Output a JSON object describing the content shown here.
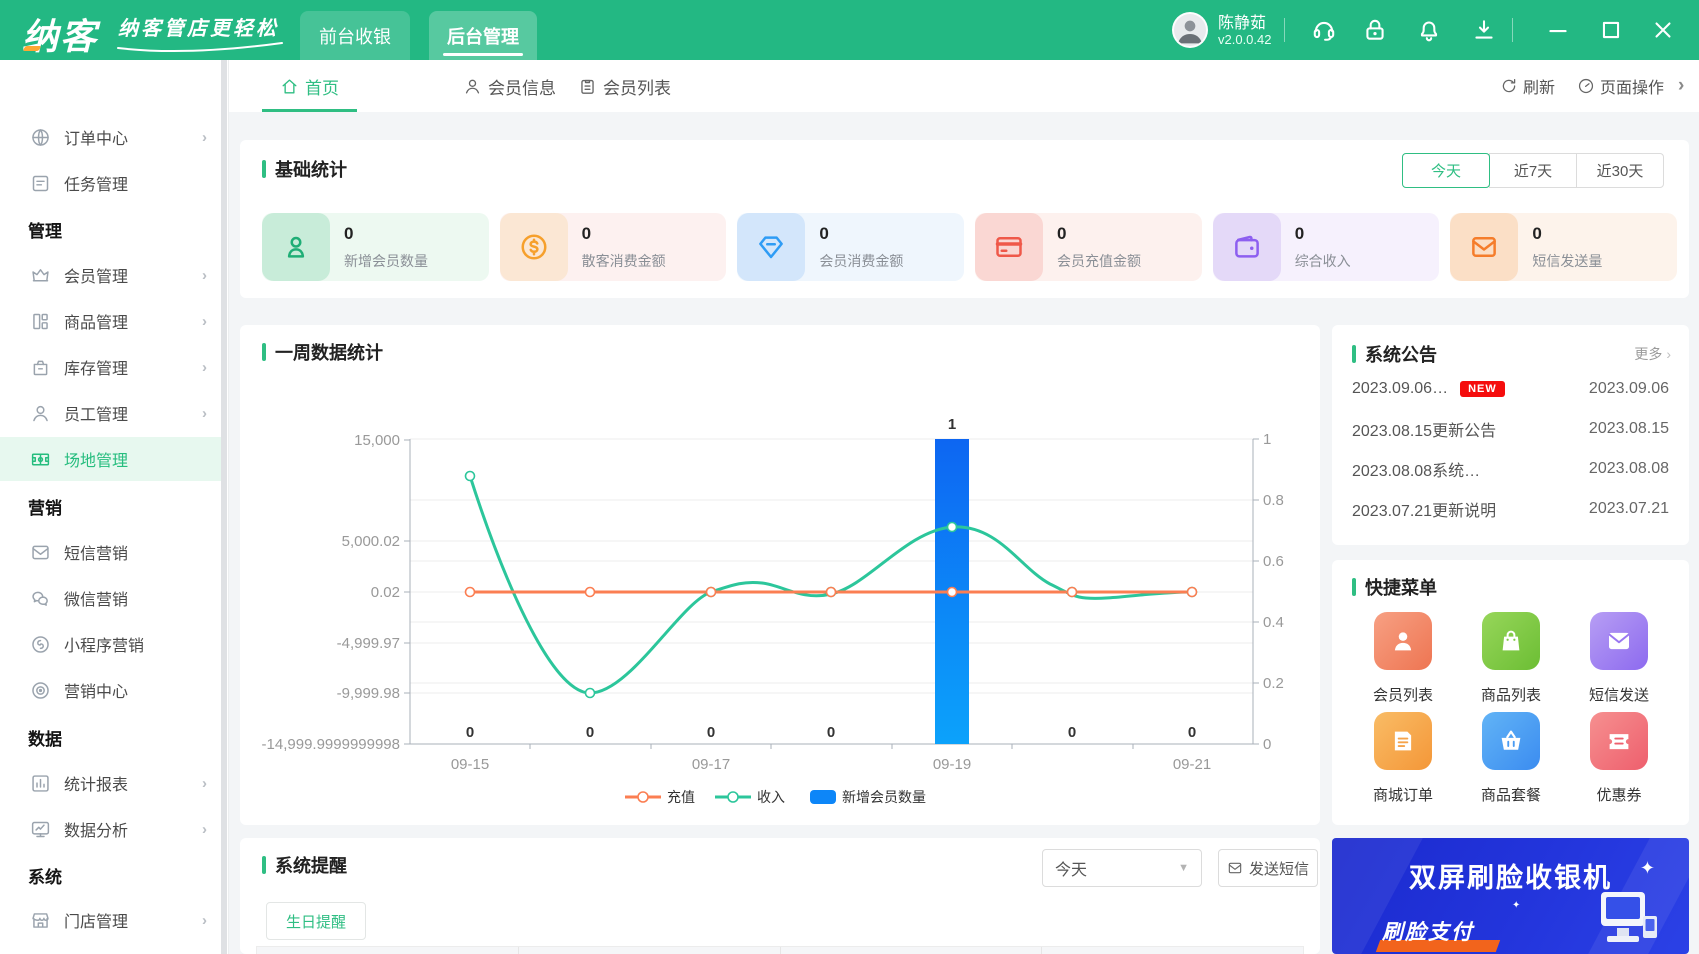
{
  "topbar": {
    "logo": "纳客",
    "slogan": "纳客管店更轻松",
    "nav_tabs": [
      {
        "label": "前台收银",
        "active": false
      },
      {
        "label": "后台管理",
        "active": true
      }
    ],
    "user": {
      "name": "陈静茹",
      "version": "v2.0.0.42"
    },
    "icons": [
      "service-headset",
      "lock",
      "bell",
      "download"
    ],
    "window_controls": [
      "minimize",
      "maximize",
      "close"
    ]
  },
  "sidebar": {
    "items": [
      {
        "type": "item",
        "label": "订单中心",
        "icon": "globe",
        "has_submenu": true
      },
      {
        "type": "item",
        "label": "任务管理",
        "icon": "task-document",
        "has_submenu": false
      },
      {
        "type": "header",
        "label": "管理"
      },
      {
        "type": "item",
        "label": "会员管理",
        "icon": "crown",
        "has_submenu": true
      },
      {
        "type": "item",
        "label": "商品管理",
        "icon": "goods",
        "has_submenu": true
      },
      {
        "type": "item",
        "label": "库存管理",
        "icon": "inventory-box",
        "has_submenu": true
      },
      {
        "type": "item",
        "label": "员工管理",
        "icon": "staff",
        "has_submenu": true
      },
      {
        "type": "item",
        "label": "场地管理",
        "icon": "sports-field",
        "has_submenu": false,
        "active": true
      },
      {
        "type": "header",
        "label": "营销"
      },
      {
        "type": "item",
        "label": "短信营销",
        "icon": "sms-mail",
        "has_submenu": false
      },
      {
        "type": "item",
        "label": "微信营销",
        "icon": "wechat",
        "has_submenu": false
      },
      {
        "type": "item",
        "label": "小程序营销",
        "icon": "mini-program",
        "has_submenu": false
      },
      {
        "type": "item",
        "label": "营销中心",
        "icon": "target",
        "has_submenu": false
      },
      {
        "type": "header",
        "label": "数据"
      },
      {
        "type": "item",
        "label": "统计报表",
        "icon": "bar-chart",
        "has_submenu": true
      },
      {
        "type": "item",
        "label": "数据分析",
        "icon": "monitor-analytics",
        "has_submenu": true
      },
      {
        "type": "header",
        "label": "系统"
      },
      {
        "type": "item",
        "label": "门店管理",
        "icon": "store",
        "has_submenu": true
      }
    ]
  },
  "tabbar": {
    "tabs": [
      {
        "label": "首页",
        "icon": "home",
        "active": true
      },
      {
        "label": "会员信息",
        "icon": "member",
        "active": false
      },
      {
        "label": "会员列表",
        "icon": "member-list",
        "active": false
      }
    ],
    "refresh_label": "刷新",
    "page_ops_label": "页面操作"
  },
  "stats": {
    "title": "基础统计",
    "ranges": [
      {
        "label": "今天",
        "active": true
      },
      {
        "label": "近7天",
        "active": false
      },
      {
        "label": "近30天",
        "active": false
      }
    ],
    "cards": [
      {
        "value": "0",
        "label": "新增会员数量",
        "icon": "member-person",
        "color": "#1fae76"
      },
      {
        "value": "0",
        "label": "散客消费金额",
        "icon": "dollar-coin",
        "color": "#f6a02c"
      },
      {
        "value": "0",
        "label": "会员消费金额",
        "icon": "diamond",
        "color": "#2e9cf5"
      },
      {
        "value": "0",
        "label": "会员充值金额",
        "icon": "bank-card",
        "color": "#ef5849"
      },
      {
        "value": "0",
        "label": "综合收入",
        "icon": "wallet",
        "color": "#8d5ff0"
      },
      {
        "value": "0",
        "label": "短信发送量",
        "icon": "envelope",
        "color": "#f57d2b"
      }
    ]
  },
  "chart_card": {
    "title": "一周数据统计"
  },
  "chart_data": {
    "type": "line+bar",
    "title": "一周数据统计",
    "categories": [
      "09-15",
      "09-16",
      "09-17",
      "09-18",
      "09-19",
      "09-20",
      "09-21"
    ],
    "x_axis_shown_labels": [
      "09-15",
      "09-17",
      "09-19",
      "09-21"
    ],
    "series": [
      {
        "name": "充值",
        "type": "line",
        "color": "#fb7e52",
        "values": [
          0.02,
          0.02,
          0.02,
          0.02,
          0.02,
          0.02,
          0.02
        ]
      },
      {
        "name": "收入",
        "type": "line",
        "color": "#2cc69b",
        "smooth": true,
        "values": [
          11500,
          -9999.98,
          0.02,
          0.02,
          6500,
          0.02,
          0.02
        ]
      },
      {
        "name": "新增会员数量",
        "type": "bar",
        "color": "#0d86f8",
        "axis": "right",
        "values": [
          0,
          0,
          0,
          0,
          1,
          0,
          0
        ],
        "labels": [
          "0",
          "0",
          "0",
          "0",
          "1",
          "0",
          "0"
        ]
      }
    ],
    "left_axis_ticks": [
      "15,000",
      "5,000.02",
      "0.02",
      "-4,999.97",
      "-9,999.98",
      "-14,999.9999999998"
    ],
    "right_axis_ticks": [
      "1",
      "0.8",
      "0.6",
      "0.4",
      "0.2",
      "0"
    ],
    "left_axis_range": [
      -15000,
      15000
    ],
    "right_axis_range": [
      0,
      1
    ],
    "grid": true,
    "legend_position": "bottom"
  },
  "announcements": {
    "title": "系统公告",
    "more_label": "更多",
    "items": [
      {
        "text": "2023.09.06…",
        "badge": "NEW",
        "date": "2023.09.06"
      },
      {
        "text": "2023.08.15更新公告",
        "badge": "",
        "date": "2023.08.15"
      },
      {
        "text": "2023.08.08系统…",
        "badge": "",
        "date": "2023.08.08"
      },
      {
        "text": "2023.07.21更新说明",
        "badge": "",
        "date": "2023.07.21"
      }
    ]
  },
  "quick_menu": {
    "title": "快捷菜单",
    "items": [
      {
        "label": "会员列表",
        "icon": "member-person",
        "color": "#f08465"
      },
      {
        "label": "商品列表",
        "icon": "shopping-bag",
        "color": "#7cc940"
      },
      {
        "label": "短信发送",
        "icon": "envelope",
        "color": "#9a77f1"
      },
      {
        "label": "商城订单",
        "icon": "order-document",
        "color": "#f5a34a"
      },
      {
        "label": "商品套餐",
        "icon": "basket",
        "color": "#4a9cf3"
      },
      {
        "label": "优惠券",
        "icon": "coupon",
        "color": "#f07a7d"
      }
    ]
  },
  "reminders": {
    "title": "系统提醒",
    "filter_value": "今天",
    "send_sms_label": "发送短信",
    "tabs": [
      {
        "label": "生日提醒",
        "active": true
      }
    ]
  },
  "banner": {
    "title": "双屏刷脸收银机",
    "subtitle": "刷脸支付"
  }
}
